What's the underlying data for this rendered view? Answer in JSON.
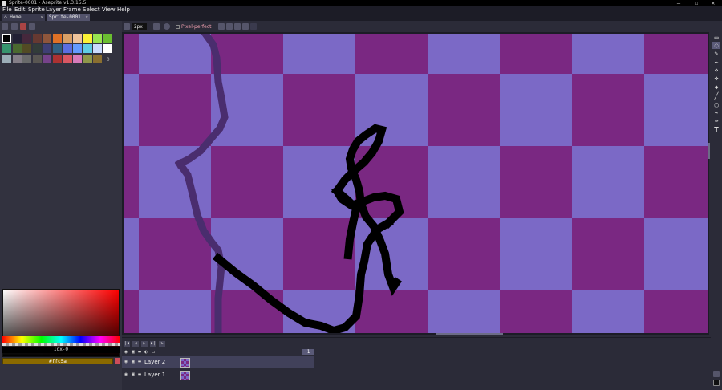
{
  "window": {
    "title": "Sprite-0001 - Aseprite v1.3.15.5",
    "controls": [
      "–",
      "☐",
      "✕"
    ]
  },
  "menu": [
    "File",
    "Edit",
    "Sprite",
    "Layer",
    "Frame",
    "Select",
    "View",
    "Help"
  ],
  "tabs": [
    {
      "label": "⌂ Home",
      "close": "✕"
    },
    {
      "label": "Sprite-0001",
      "close": "✕"
    }
  ],
  "palette": {
    "colors": [
      "#000000",
      "#222034",
      "#45283c",
      "#663931",
      "#8f563b",
      "#df7126",
      "#d9a066",
      "#eec39a",
      "#fbf236",
      "#99e550",
      "#6abe30",
      "#37946e",
      "#4b692f",
      "#524b24",
      "#323c39",
      "#3f3f74",
      "#306082",
      "#5b6ee1",
      "#639bff",
      "#5fcde4",
      "#cbdbfc",
      "#ffffff",
      "#9badb7",
      "#847e87",
      "#696a6a",
      "#595652",
      "#76428a",
      "#ac3232",
      "#d95763",
      "#d77bba",
      "#8f974a",
      "#8a6f30"
    ],
    "count_label": "0"
  },
  "color": {
    "index_label": "Idx-0",
    "foreground_hex": "#ffc5a",
    "foreground_swatch": "#8b6a00",
    "background_swatch": "#cc4d5a"
  },
  "context_bar": {
    "brush_size": "2px",
    "pixel_perfect_label": "Pixel-perfect"
  },
  "tools": [
    "▭",
    "◌",
    "✎",
    "✒",
    "⋄",
    "✥",
    "◆",
    "╱",
    "▢",
    "⌁",
    "✑",
    "T"
  ],
  "timeline": {
    "frame_number": "1",
    "buttons": [
      "|◀",
      "◀",
      "▶",
      "▶|",
      "↻"
    ],
    "layers": [
      {
        "name": "Layer 2",
        "active": true
      },
      {
        "name": "Layer 1",
        "active": false
      }
    ]
  }
}
